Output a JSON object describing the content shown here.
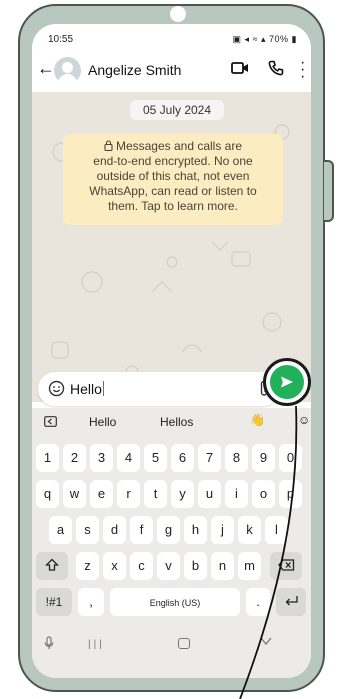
{
  "status_bar": {
    "time": "10:55",
    "battery": "70%"
  },
  "app_bar": {
    "contact_name": "Angelize Smith"
  },
  "chat": {
    "date": "05 July 2024",
    "encryption_lines": [
      "Messages and calls are",
      "end-to-end encrypted. No one",
      "outside of this chat, not even",
      "WhatsApp, can read or listen to",
      "them. Tap to learn more."
    ]
  },
  "composer": {
    "text": "Hello"
  },
  "keyboard": {
    "suggestions": [
      "Hello",
      "Hellos"
    ],
    "suggestion_emoji": "👋",
    "row1": [
      "1",
      "2",
      "3",
      "4",
      "5",
      "6",
      "7",
      "8",
      "9",
      "0"
    ],
    "row2": [
      "q",
      "w",
      "e",
      "r",
      "t",
      "y",
      "u",
      "i",
      "o",
      "p"
    ],
    "row3": [
      "a",
      "s",
      "d",
      "f",
      "g",
      "h",
      "j",
      "k",
      "l"
    ],
    "row4": [
      "z",
      "x",
      "c",
      "v",
      "b",
      "n",
      "m"
    ],
    "symbols_label": "!#1",
    "comma": ",",
    "space_label": "English (US)",
    "period": "."
  },
  "colors": {
    "send_green": "#22b05a",
    "notice_bg": "#fbecc1",
    "chat_bg": "#e9e5dd",
    "phone_frame": "#b9c7c1"
  },
  "icons": [
    "back-icon",
    "video-icon",
    "call-icon",
    "more-icon",
    "lock-icon",
    "emoji-icon",
    "attach-icon",
    "send-icon",
    "shift-icon",
    "backspace-icon",
    "enter-icon",
    "mic-icon"
  ]
}
